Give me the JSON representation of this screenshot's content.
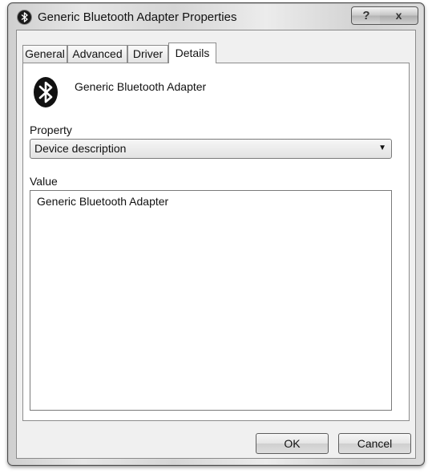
{
  "window": {
    "title": "Generic Bluetooth Adapter Properties",
    "help_label": "?",
    "close_label": "x",
    "title_icon": "bluetooth-icon"
  },
  "tabs": [
    {
      "label": "General",
      "active": false
    },
    {
      "label": "Advanced",
      "active": false
    },
    {
      "label": "Driver",
      "active": false
    },
    {
      "label": "Details",
      "active": true
    }
  ],
  "details": {
    "device_icon": "bluetooth-icon",
    "device_name": "Generic Bluetooth Adapter",
    "property_label": "Property",
    "property_selected": "Device description",
    "value_label": "Value",
    "values": [
      "Generic Bluetooth Adapter"
    ]
  },
  "buttons": {
    "ok": "OK",
    "cancel": "Cancel"
  }
}
